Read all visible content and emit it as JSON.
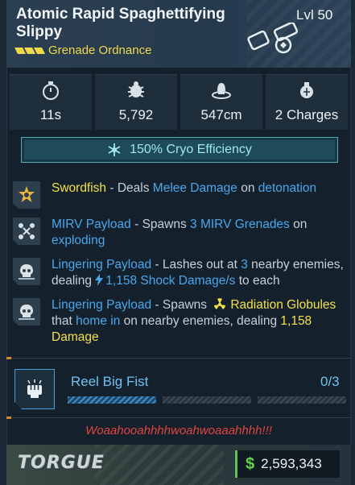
{
  "item": {
    "name": "Atomic Rapid Spaghettifying Slippy",
    "level": "Lvl 50",
    "type": "Grenade Ordnance",
    "rarity_color": "#f0d94a"
  },
  "stats": [
    {
      "icon": "stopwatch-icon",
      "value": "11s"
    },
    {
      "icon": "damage-icon",
      "value": "5,792"
    },
    {
      "icon": "radius-icon",
      "value": "547cm"
    },
    {
      "icon": "grenade-charges-icon",
      "value": "2 Charges"
    }
  ],
  "element_bonus": {
    "icon": "snowflake-icon",
    "text": "150% Cryo Efficiency",
    "color": "#9fe6ef"
  },
  "perks": [
    {
      "icon": "star-burst-icon",
      "name": "Swordfish",
      "text_1": " - Deals ",
      "hl_1": "Melee Damage",
      "text_2": " on ",
      "hl_2": "detonation"
    },
    {
      "icon": "mirv-icon",
      "name": "MIRV Payload",
      "text_1": " - Spawns ",
      "hl_1": "3 MIRV Grenades",
      "text_2": " on ",
      "hl_2": "exploding"
    },
    {
      "icon": "skull-icon",
      "name": "Lingering Payload",
      "text_1": " - Lashes out at ",
      "hl_1": "3",
      "text_2": " nearby enemies, dealing ",
      "hl_2": "1,158 Shock Damage/s",
      "text_3": " to each"
    },
    {
      "icon": "skull-icon",
      "name": "Lingering Payload",
      "text_1": " - Spawns ",
      "hl_1": "Radiation Globules",
      "text_2": " that ",
      "hl_2": "home in",
      "text_3": " on nearby enemies, dealing ",
      "hl_3": "1,158 Damage"
    }
  ],
  "overclock": {
    "icon": "fist-icon",
    "name": "Reel Big Fist",
    "count": "0/3",
    "progress": 0.33
  },
  "flavor_text": "Woaahooahhhhwoahwoaaahhhh!!!",
  "footer": {
    "manufacturer": "TORGUE",
    "currency_symbol": "$",
    "price": "2,593,343"
  },
  "colors": {
    "highlight_yellow": "#f2e04a",
    "highlight_blue": "#4aa6ec",
    "flavor_red": "#e2453f",
    "price_green": "#66d24e"
  }
}
